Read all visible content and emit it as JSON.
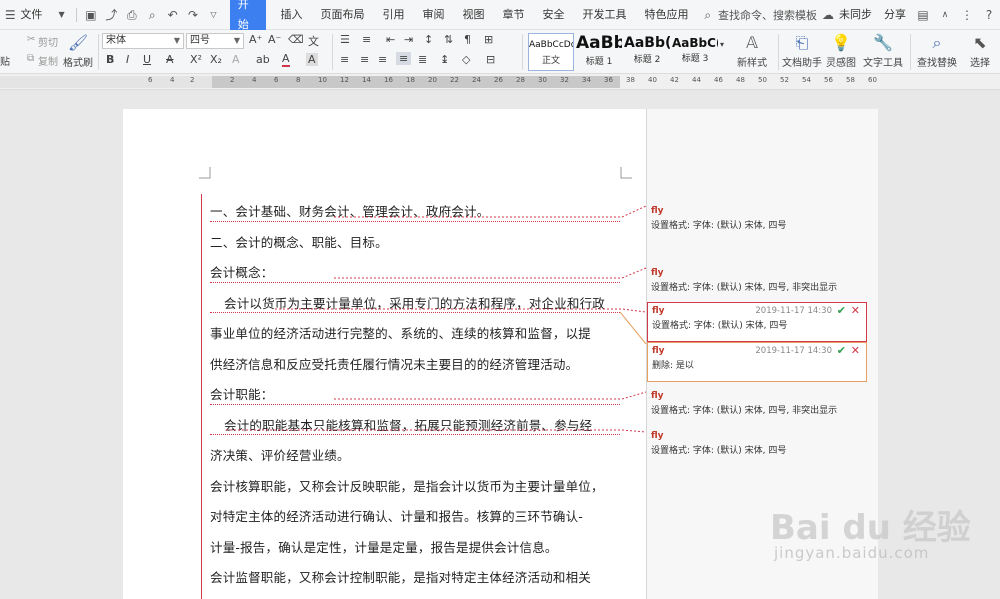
{
  "menubar": {
    "file": "文件",
    "tabs": [
      "开始",
      "插入",
      "页面布局",
      "引用",
      "审阅",
      "视图",
      "章节",
      "安全",
      "开发工具",
      "特色应用"
    ],
    "search": "查找命令、搜索模板",
    "sync": "未同步",
    "share": "分享"
  },
  "ribbon": {
    "cut": "剪切",
    "copy": "复制",
    "paste": "贴",
    "format_painter": "格式刷",
    "font_name": "宋体",
    "font_size": "四号",
    "styles": [
      {
        "preview": "AaBbCcDd",
        "name": "正文"
      },
      {
        "preview": "AaBb",
        "name": "标题 1"
      },
      {
        "preview": "AaBb(",
        "name": "标题 2"
      },
      {
        "preview": "AaBbC(",
        "name": "标题 3"
      }
    ],
    "new_style": "新样式",
    "doc_assistant": "文档助手",
    "inspiration": "灵感图",
    "text_tools": "文字工具",
    "find_replace": "查找替换",
    "select": "选择"
  },
  "ruler": {
    "numbers": [
      "6",
      "4",
      "2",
      "2",
      "4",
      "6",
      "8",
      "10",
      "12",
      "14",
      "16",
      "18",
      "20",
      "22",
      "24",
      "26",
      "28",
      "30",
      "32",
      "34",
      "36",
      "38",
      "40",
      "42",
      "44",
      "46",
      "48",
      "50",
      "52",
      "54",
      "56",
      "58",
      "60"
    ]
  },
  "document": {
    "paragraphs": [
      "一、会计基础、财务会计、管理会计、政府会计。",
      "二、会计的概念、职能、目标。",
      "会计概念：",
      "会计以货币为主要计量单位，采用专门的方法和程序，对企业和行政",
      "事业单位的经济活动进行完整的、系统的、连续的核算和监督，以提",
      "供经济信息和反应受托责任履行情况未主要目的的经济管理活动。",
      "会计职能：",
      "会计的职能基本只能核算和监督，拓展只能预测经济前景、参与经",
      "济决策、评价经营业绩。",
      "会计核算职能，又称会计反映职能，是指会计以货币为主要计量单位，",
      "对特定主体的经济活动进行确认、计量和报告。核算的三环节确认-",
      "计量-报告，确认是定性，计量是定量，报告是提供会计信息。",
      "会计监督职能，又称会计控制职能，是指对特定主体经济活动和相关"
    ]
  },
  "comments": [
    {
      "author": "fly",
      "time": "",
      "body": "设置格式: 字体: (默认) 宋体, 四号"
    },
    {
      "author": "fly",
      "time": "",
      "body": "设置格式: 字体: (默认) 宋体, 四号, 非突出显示"
    },
    {
      "author": "fly",
      "time": "2019-11-17 14:30",
      "body": "设置格式: 字体: (默认) 宋体, 四号"
    },
    {
      "author": "fly",
      "time": "2019-11-17 14:30",
      "body": "删除: 是以"
    },
    {
      "author": "fly",
      "time": "",
      "body": "设置格式: 字体: (默认) 宋体, 四号, 非突出显示"
    },
    {
      "author": "fly",
      "time": "",
      "body": "设置格式: 字体: (默认) 宋体, 四号"
    }
  ],
  "watermark": {
    "logo": "Bai du 经验",
    "url": "jingyan.baidu.com"
  }
}
